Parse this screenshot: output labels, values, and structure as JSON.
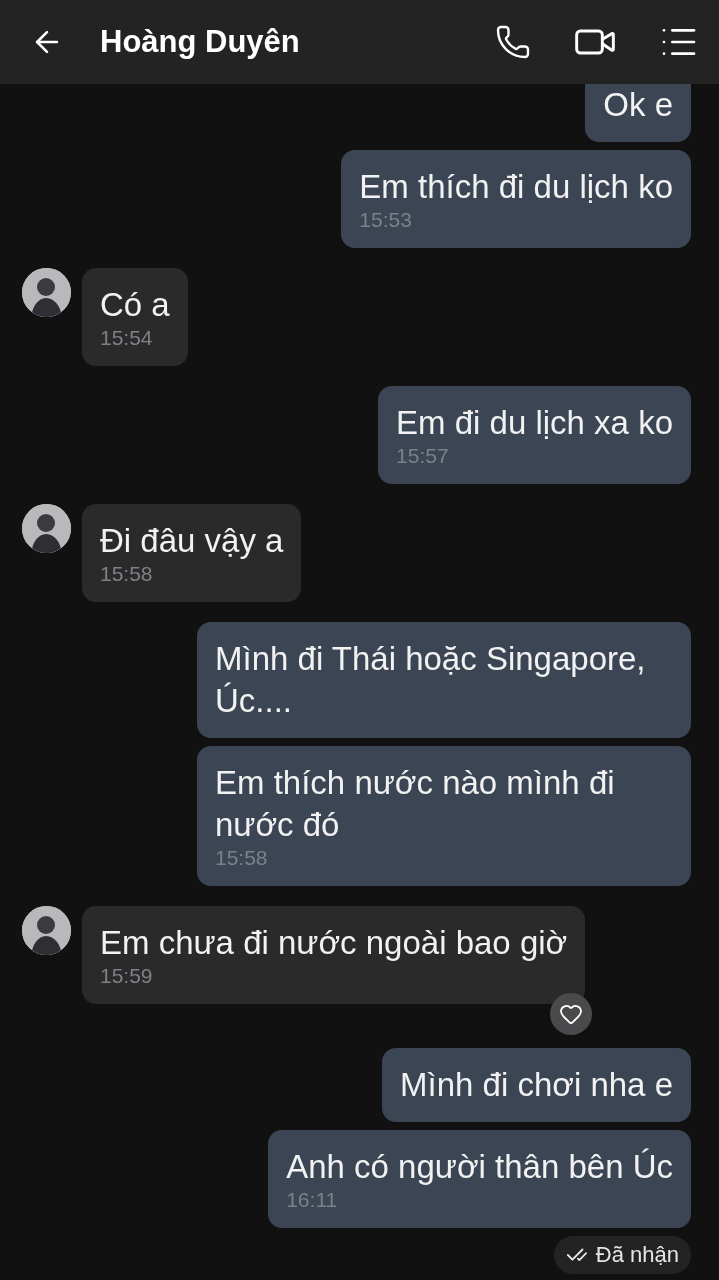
{
  "header": {
    "title": "Hoàng Duyên"
  },
  "messages": [
    {
      "outgoing": true,
      "text": "Ok e"
    },
    {
      "outgoing": true,
      "text": "Em thích đi du lịch ko",
      "time": "15:53"
    },
    {
      "outgoing": false,
      "text": "Có a",
      "time": "15:54"
    },
    {
      "outgoing": true,
      "text": "Em đi du lịch xa ko",
      "time": "15:57"
    },
    {
      "outgoing": false,
      "text": "Đi đâu vậy a",
      "time": "15:58"
    },
    {
      "outgoing": true,
      "text": "Mình đi Thái hoặc Singapore, Úc...."
    },
    {
      "outgoing": true,
      "text": "Em thích nước nào mình đi nước đó",
      "time": "15:58"
    },
    {
      "outgoing": false,
      "text": "Em chưa đi nước ngoài bao giờ",
      "time": "15:59",
      "liked": true
    },
    {
      "outgoing": true,
      "text": "Mình đi chơi nha e"
    },
    {
      "outgoing": true,
      "text": "Anh có người thân bên Úc",
      "time": "16:11"
    }
  ],
  "receipt": "Đã nhận"
}
